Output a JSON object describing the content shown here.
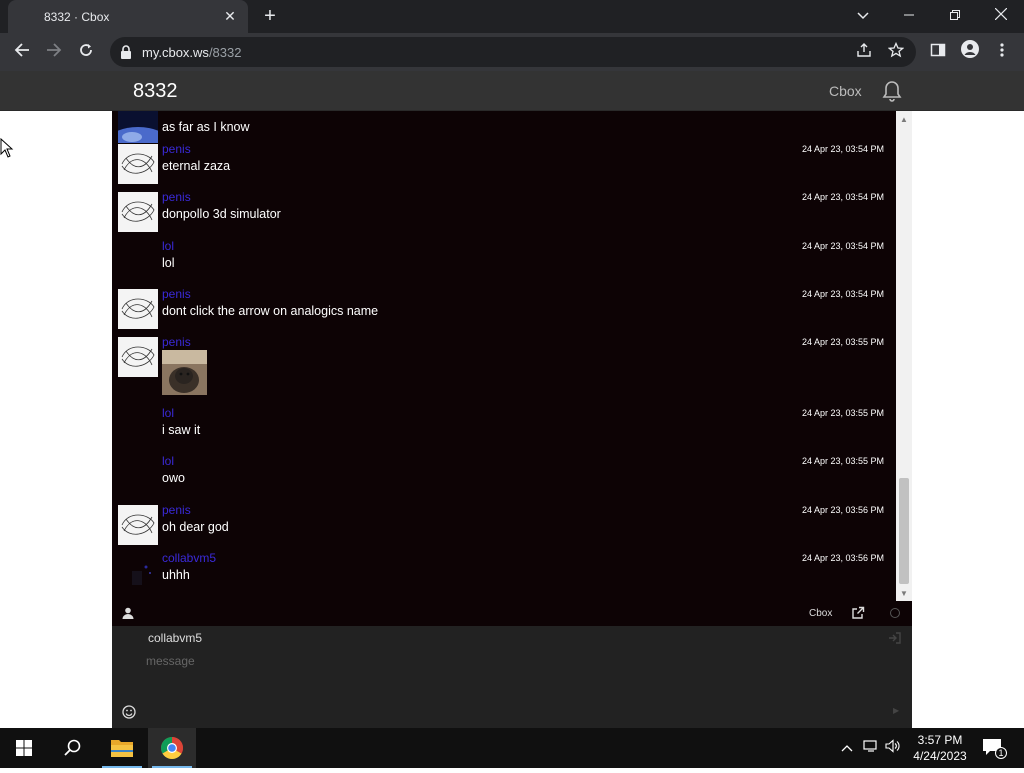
{
  "browser": {
    "tab_title": "8332 · Cbox",
    "url_host": "my.cbox.ws",
    "url_path": "/8332"
  },
  "cbox": {
    "title": "8332",
    "brand_link": "Cbox",
    "colors": {
      "background": "#0d0305",
      "username": "#3a2ad8",
      "text": "#ffffff"
    }
  },
  "messages": [
    {
      "user": "",
      "text": "as far as I know",
      "time": "",
      "avatar": "earth"
    },
    {
      "user": "penis",
      "text": "eternal zaza",
      "time": "24 Apr 23, 03:54 PM",
      "avatar": "scribble"
    },
    {
      "user": "penis",
      "text": "donpollo 3d simulator",
      "time": "24 Apr 23, 03:54 PM",
      "avatar": "scribble"
    },
    {
      "user": "lol",
      "text": "lol",
      "time": "24 Apr 23, 03:54 PM",
      "avatar": "none"
    },
    {
      "user": "penis",
      "text": "dont click the arrow on analogics name",
      "time": "24 Apr 23, 03:54 PM",
      "avatar": "scribble"
    },
    {
      "user": "penis",
      "text": "",
      "time": "24 Apr 23, 03:55 PM",
      "avatar": "scribble",
      "image": "photo"
    },
    {
      "user": "lol",
      "text": "i saw it",
      "time": "24 Apr 23, 03:55 PM",
      "avatar": "none"
    },
    {
      "user": "lol",
      "text": "owo",
      "time": "24 Apr 23, 03:55 PM",
      "avatar": "none"
    },
    {
      "user": "penis",
      "text": "oh dear god",
      "time": "24 Apr 23, 03:56 PM",
      "avatar": "scribble"
    },
    {
      "user": "collabvm5",
      "text": "uhhh",
      "time": "24 Apr 23, 03:56 PM",
      "avatar": "dark"
    }
  ],
  "statusbar": {
    "cbox_label": "Cbox"
  },
  "compose": {
    "nickname": "collabvm5",
    "placeholder": "message"
  },
  "taskbar": {
    "time": "3:57 PM",
    "date": "4/24/2023",
    "notification_count": "1"
  }
}
